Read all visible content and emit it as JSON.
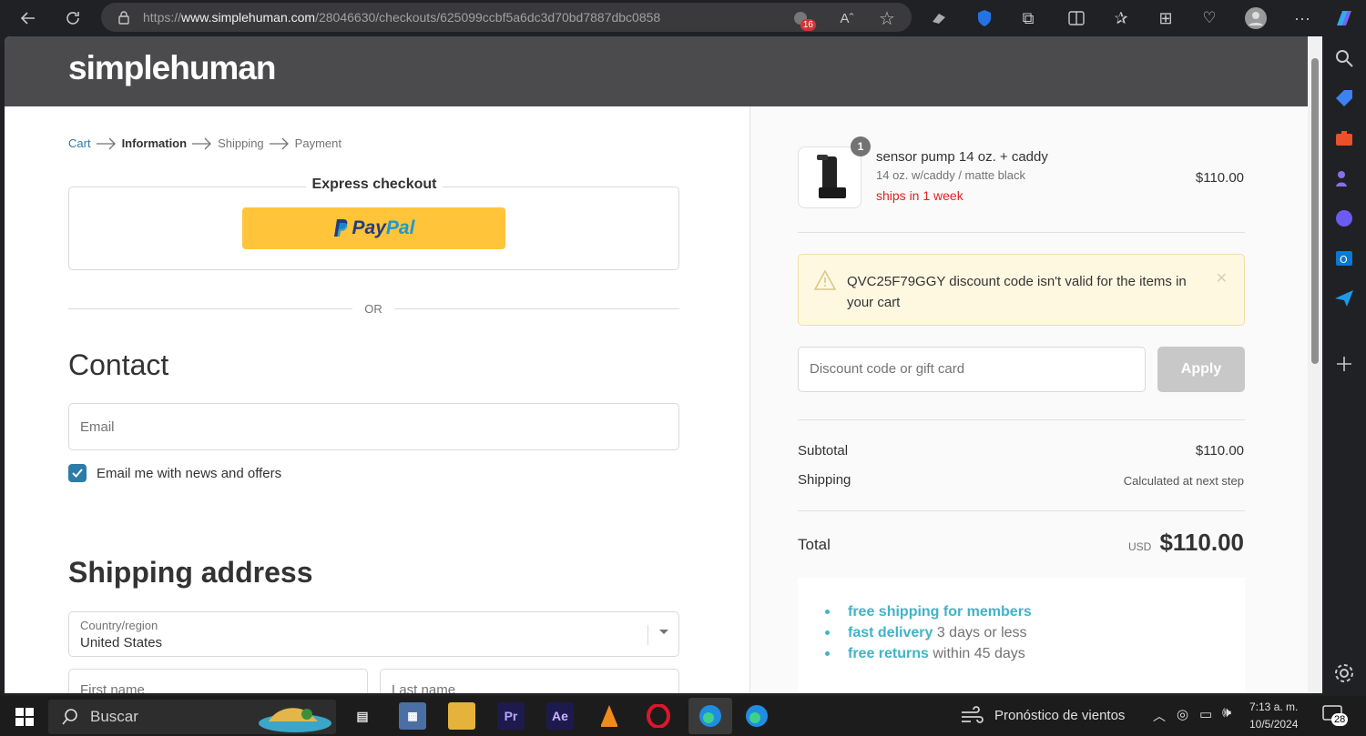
{
  "browser": {
    "url_prefix": "https://",
    "url_domain": "www.simplehuman.com",
    "url_path": "/28046630/checkouts/625099ccbf5a6dc3d70bd7887dbc0858",
    "extensions_badge": "16"
  },
  "site": {
    "logo": "simplehuman"
  },
  "breadcrumb": {
    "cart": "Cart",
    "information": "Information",
    "shipping": "Shipping",
    "payment": "Payment"
  },
  "express": {
    "title": "Express checkout",
    "paypal_a": "Pay",
    "paypal_b": "Pal",
    "or": "OR"
  },
  "contact": {
    "heading": "Contact",
    "email_placeholder": "Email",
    "newsletter_label": "Email me with news and offers",
    "newsletter_checked": true
  },
  "shipping_address": {
    "heading": "Shipping address",
    "country_label": "Country/region",
    "country_value": "United States",
    "first_name_placeholder": "First name",
    "last_name_placeholder": "Last name"
  },
  "order": {
    "item": {
      "quantity": "1",
      "name": "sensor pump 14 oz. + caddy",
      "variant": "14 oz. w/caddy / matte black",
      "ships": "ships in 1 week",
      "price": "$110.00"
    },
    "warning": "QVC25F79GGY discount code isn't valid for the items in your cart",
    "discount_placeholder": "Discount code or gift card",
    "apply_label": "Apply",
    "subtotal_label": "Subtotal",
    "subtotal_value": "$110.00",
    "shipping_label": "Shipping",
    "shipping_value": "Calculated at next step",
    "total_label": "Total",
    "currency": "USD",
    "total_value": "$110.00",
    "perks": [
      {
        "highlight": "free shipping for members",
        "rest": ""
      },
      {
        "highlight": "fast delivery",
        "rest": " 3 days or less"
      },
      {
        "highlight": "free returns",
        "rest": " within 45 days"
      }
    ]
  },
  "taskbar": {
    "search_placeholder": "Buscar",
    "weather": "Pronóstico de vientos",
    "time": "7:13 a. m.",
    "date": "10/5/2024",
    "notifications": "28",
    "apps": [
      "Pr",
      "Ae"
    ]
  },
  "colors": {
    "accent": "#2d7ba8",
    "paypal": "#ffc439",
    "perk": "#41b3c7",
    "warning_bg": "#fff8e1",
    "ships": "#e22120"
  }
}
